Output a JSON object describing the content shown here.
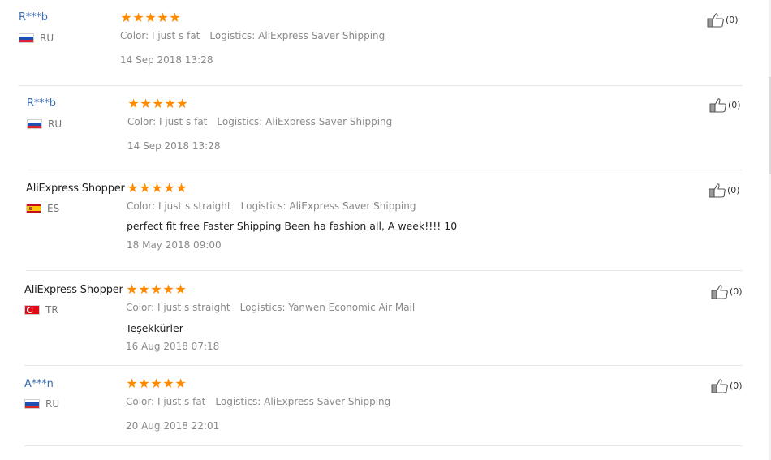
{
  "reviews": [
    {
      "user": "R***b",
      "user_style": "link",
      "country_code": "RU",
      "flag": "ru",
      "stars": 5,
      "color": "Color: I just s fat",
      "logistics": "Logistics: AliExpress Saver Shipping",
      "feedback": "",
      "date": "14 Sep 2018 13:28",
      "helpful": "(0)"
    },
    {
      "user": "R***b",
      "user_style": "link",
      "country_code": "RU",
      "flag": "ru",
      "stars": 5,
      "color": "Color: I just s fat",
      "logistics": "Logistics: AliExpress Saver Shipping",
      "feedback": "",
      "date": "14 Sep 2018 13:28",
      "helpful": "(0)"
    },
    {
      "user": "AliExpress Shopper",
      "user_style": "plain",
      "country_code": "ES",
      "flag": "es",
      "stars": 5,
      "color": "Color: I just s straight",
      "logistics": "Logistics: AliExpress Saver Shipping",
      "feedback": "perfect fit free Faster Shipping Been ha fashion all, A week!!!! 10",
      "date": "18 May 2018 09:00",
      "helpful": "(0)"
    },
    {
      "user": "AliExpress Shopper",
      "user_style": "plain",
      "country_code": "TR",
      "flag": "tr",
      "stars": 5,
      "color": "Color: I just s straight",
      "logistics": "Logistics: Yanwen Economic Air Mail",
      "feedback": "Teşekkürler",
      "date": "16 Aug 2018 07:18",
      "helpful": "(0)"
    },
    {
      "user": "A***n",
      "user_style": "link",
      "country_code": "RU",
      "flag": "ru",
      "stars": 5,
      "color": "Color: I just s fat",
      "logistics": "Logistics: AliExpress Saver Shipping",
      "feedback": "",
      "date": "20 Aug 2018 22:01",
      "helpful": "(0)"
    }
  ],
  "icons": {
    "star": "star-icon",
    "helpful": "thumbs-up-icon"
  },
  "colors": {
    "star": "#ff8a00",
    "link": "#3b6fb6",
    "meta": "#8a8a8a",
    "divider": "#e8e8e8"
  }
}
